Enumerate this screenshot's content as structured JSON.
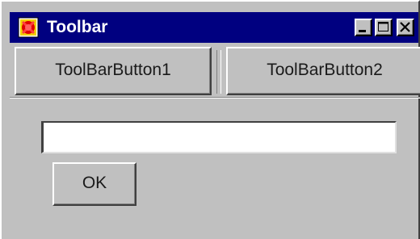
{
  "window": {
    "title": "Toolbar",
    "app_icon": "app-icon",
    "controls": {
      "minimize_icon": "minimize-icon",
      "maximize_icon": "maximize-icon",
      "close_icon": "close-icon"
    }
  },
  "toolbar": {
    "buttons": [
      {
        "label": "ToolBarButton1"
      },
      {
        "label": "ToolBarButton2"
      }
    ]
  },
  "form": {
    "text_value": "",
    "ok_label": "OK"
  },
  "colors": {
    "titlebar": "#000080",
    "face": "#c0c0c0"
  }
}
